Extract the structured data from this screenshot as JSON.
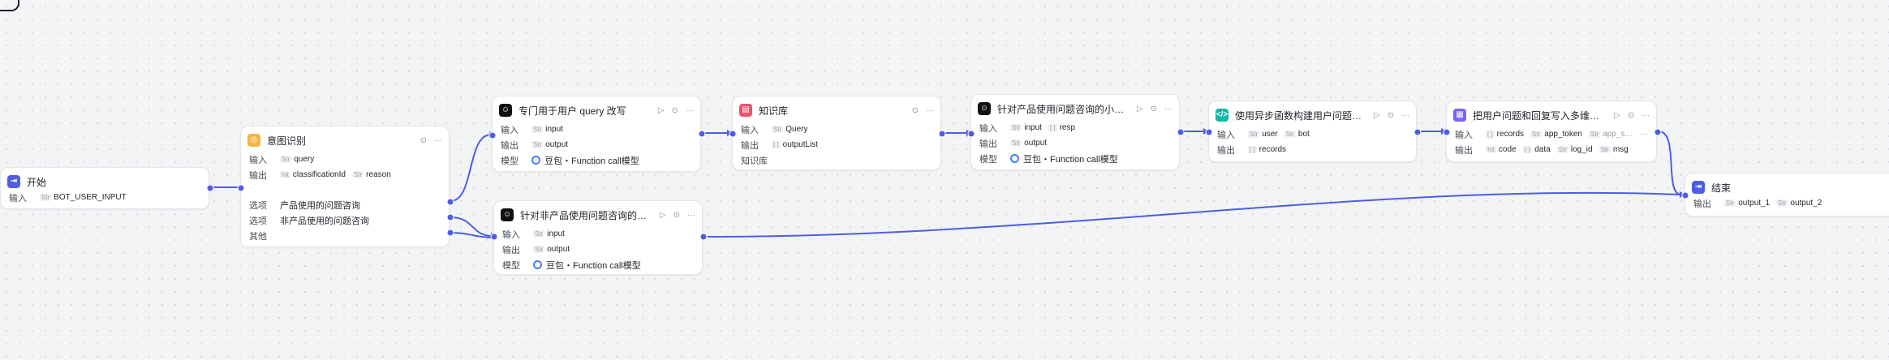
{
  "icons": {
    "start": "login-icon",
    "intent": "intent-icon",
    "llm": "robot-icon",
    "knowledge": "knowledge-icon",
    "code": "code-icon",
    "plugin": "table-icon",
    "end": "logout-icon"
  },
  "colors": {
    "edge": "#4e5de3",
    "start": "#4e5de3",
    "intent": "#f5b544",
    "llm": "#111111",
    "knowledge": "#f0506e",
    "code": "#10b8a6",
    "plugin": "#7b61ff",
    "end": "#4e5de3"
  },
  "labels": {
    "input": "输入",
    "output": "输出",
    "model": "模型",
    "option": "选项",
    "other": "其他",
    "knowledge": "知识库"
  },
  "nodes": {
    "start": {
      "title": "开始",
      "inputs": [
        {
          "type": "Str",
          "name": "BOT_USER_INPUT"
        }
      ]
    },
    "intent": {
      "title": "意图识别",
      "inputs": [
        {
          "type": "Str",
          "name": "query"
        }
      ],
      "outputs": [
        {
          "type": "Int",
          "name": "classificationId"
        },
        {
          "type": "Str",
          "name": "reason"
        }
      ],
      "options": [
        "产品使用的问题咨询",
        "非产品使用的问题咨询"
      ]
    },
    "llm_rewrite": {
      "title": "专门用于用户 query 改写",
      "inputs": [
        {
          "type": "Str",
          "name": "input"
        }
      ],
      "outputs": [
        {
          "type": "Str",
          "name": "output"
        }
      ],
      "model": "豆包・Function call模型"
    },
    "knowledge": {
      "title": "知识库",
      "inputs": [
        {
          "type": "Str",
          "name": "Query"
        }
      ],
      "outputs": [
        {
          "type": "[ ]",
          "name": "outputList"
        }
      ]
    },
    "llm_product": {
      "title": "针对产品使用问题咨询的小助手解…",
      "inputs": [
        {
          "type": "Str",
          "name": "input"
        },
        {
          "type": "[ ]",
          "name": "resp"
        }
      ],
      "outputs": [
        {
          "type": "Str",
          "name": "output"
        }
      ],
      "model": "豆包・Function call模型"
    },
    "llm_general": {
      "title": "针对非产品使用问题咨询的通用解…",
      "inputs": [
        {
          "type": "Str",
          "name": "input"
        }
      ],
      "outputs": [
        {
          "type": "Str",
          "name": "output"
        }
      ],
      "model": "豆包・Function call模型"
    },
    "code": {
      "title": "使用异步函数构建用户问题和回复…",
      "inputs": [
        {
          "type": "Str",
          "name": "user"
        },
        {
          "type": "Str",
          "name": "bot"
        }
      ],
      "outputs": [
        {
          "type": "[ ]",
          "name": "records"
        }
      ]
    },
    "plugin": {
      "title": "把用户问题和回复写入多维表格",
      "inputs": [
        {
          "type": "[ ]",
          "name": "records"
        },
        {
          "type": "Str",
          "name": "app_token"
        },
        {
          "type": "Str",
          "name": "app_s…"
        }
      ],
      "outputs": [
        {
          "type": "Int",
          "name": "code"
        },
        {
          "type": "{ }",
          "name": "data"
        },
        {
          "type": "Str",
          "name": "log_id"
        },
        {
          "type": "Str",
          "name": "msg"
        }
      ],
      "more": "···"
    },
    "end": {
      "title": "结束",
      "outputs": [
        {
          "type": "Str",
          "name": "output_1"
        },
        {
          "type": "Str",
          "name": "output_2"
        }
      ]
    }
  },
  "tools": {
    "run": "▷",
    "retry": "⊙",
    "more": "···"
  }
}
